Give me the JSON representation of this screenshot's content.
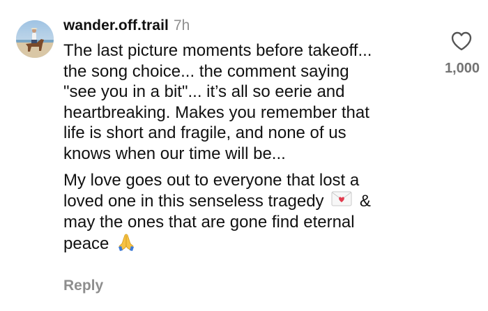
{
  "comment": {
    "avatar_icon": "profile-photo-rider-on-horse",
    "username": "wander.off.trail",
    "time": "7h",
    "paragraph1": {
      "lines": [
        "The last picture moments before takeoff...",
        "the song choice... the comment saying",
        "\"see you in a bit\"... it’s all so eerie and",
        "heartbreaking. Makes you remember that",
        "life is short and fragile, and none of us",
        "knows when our time will be..."
      ]
    },
    "paragraph2": {
      "line1": "My love goes out to everyone that lost a",
      "line2_before": "loved one in this senseless tragedy",
      "line2_emoji": "love-letter-emoji",
      "line2_after": "&",
      "line3": "may the ones that are gone find eternal",
      "line4_before": "peace",
      "line4_emoji": "folded-hands-emoji"
    },
    "reply_label": "Reply",
    "like_icon": "heart-outline-icon",
    "like_count": "1,000"
  }
}
